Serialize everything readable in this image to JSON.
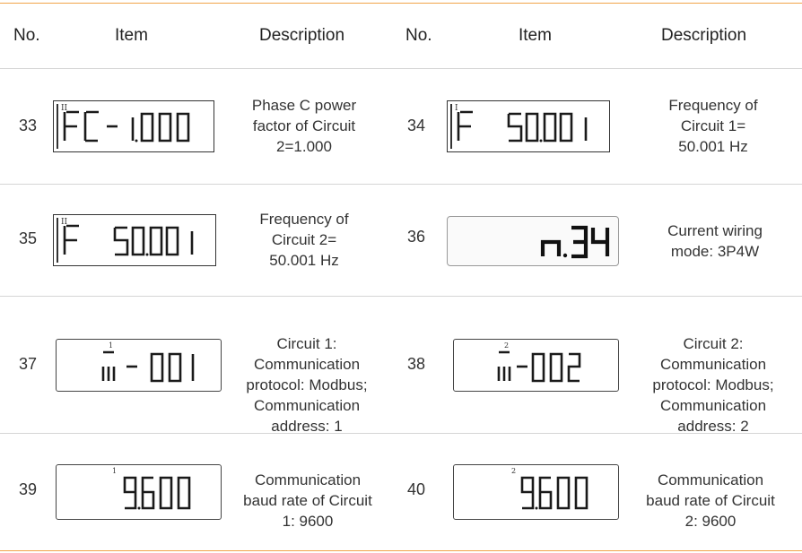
{
  "headers": {
    "no_left": "No.",
    "item_left": "Item",
    "desc_left": "Description",
    "no_right": "No.",
    "item_right": "Item",
    "desc_right": "Description"
  },
  "rows": [
    {
      "left": {
        "no": "33",
        "display": "FC- 1.000",
        "circuit_mark": "II",
        "desc": [
          "Phase C power",
          "factor of Circuit",
          "2=1.000"
        ]
      },
      "right": {
        "no": "34",
        "display": "F 50.001",
        "circuit_mark": "I",
        "desc": [
          "Frequency of",
          "Circuit 1=",
          "50.001 Hz"
        ]
      }
    },
    {
      "left": {
        "no": "35",
        "display": "F 50.001",
        "circuit_mark": "II",
        "desc": [
          "Frequency of",
          "Circuit 2=",
          "50.001 Hz"
        ]
      },
      "right": {
        "no": "36",
        "display": "n.34",
        "circuit_mark": "",
        "desc": [
          "Current wiring",
          "mode: 3P4W"
        ]
      }
    },
    {
      "left": {
        "no": "37",
        "display": "m- 001",
        "circuit_mark": "1",
        "desc": [
          "Circuit 1:",
          "Communication",
          "protocol: Modbus;",
          "Communication",
          "address: 1"
        ]
      },
      "right": {
        "no": "38",
        "display": "m-002",
        "circuit_mark": "2",
        "desc": [
          "Circuit 2:",
          "Communication",
          "protocol: Modbus;",
          "Communication",
          "address: 2"
        ]
      }
    },
    {
      "left": {
        "no": "39",
        "display": "9600",
        "circuit_mark": "1",
        "desc": [
          "Communication",
          "baud rate of Circuit",
          "1: 9600"
        ]
      },
      "right": {
        "no": "40",
        "display": "9600",
        "circuit_mark": "2",
        "desc": [
          "Communication",
          "baud rate of Circuit",
          "2: 9600"
        ]
      }
    }
  ]
}
